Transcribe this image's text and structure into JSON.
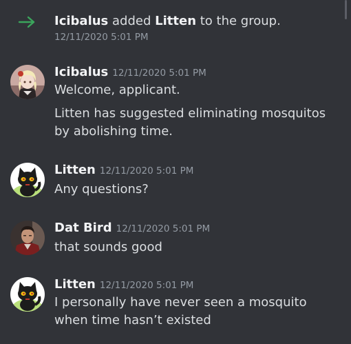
{
  "system_message": {
    "actor": "Icibalus",
    "verb": "added",
    "target": "Litten",
    "suffix": "to the group.",
    "timestamp": "12/11/2020 5:01 PM",
    "icon": "arrow-right-icon",
    "icon_color": "#3ba55c"
  },
  "messages": [
    {
      "author": "Icibalus",
      "timestamp": "12/11/2020 5:01 PM",
      "avatar": "anime-character-avatar",
      "lines": [
        "Welcome, applicant.",
        "Litten has suggested eliminating mosquitos by abolishing time."
      ]
    },
    {
      "author": "Litten",
      "timestamp": "12/11/2020 5:01 PM",
      "avatar": "black-cat-avatar",
      "lines": [
        "Any questions?"
      ]
    },
    {
      "author": "Dat Bird",
      "timestamp": "12/11/2020 5:01 PM",
      "avatar": "man-portrait-avatar",
      "lines": [
        "that sounds good"
      ]
    },
    {
      "author": "Litten",
      "timestamp": "12/11/2020 5:01 PM",
      "avatar": "black-cat-avatar",
      "lines": [
        "I personally have never seen a mosquito when time hasn’t existed"
      ]
    }
  ],
  "colors": {
    "background": "#313338",
    "text": "#dbdee1",
    "author": "#f2f3f5",
    "timestamp": "#949ba4"
  }
}
